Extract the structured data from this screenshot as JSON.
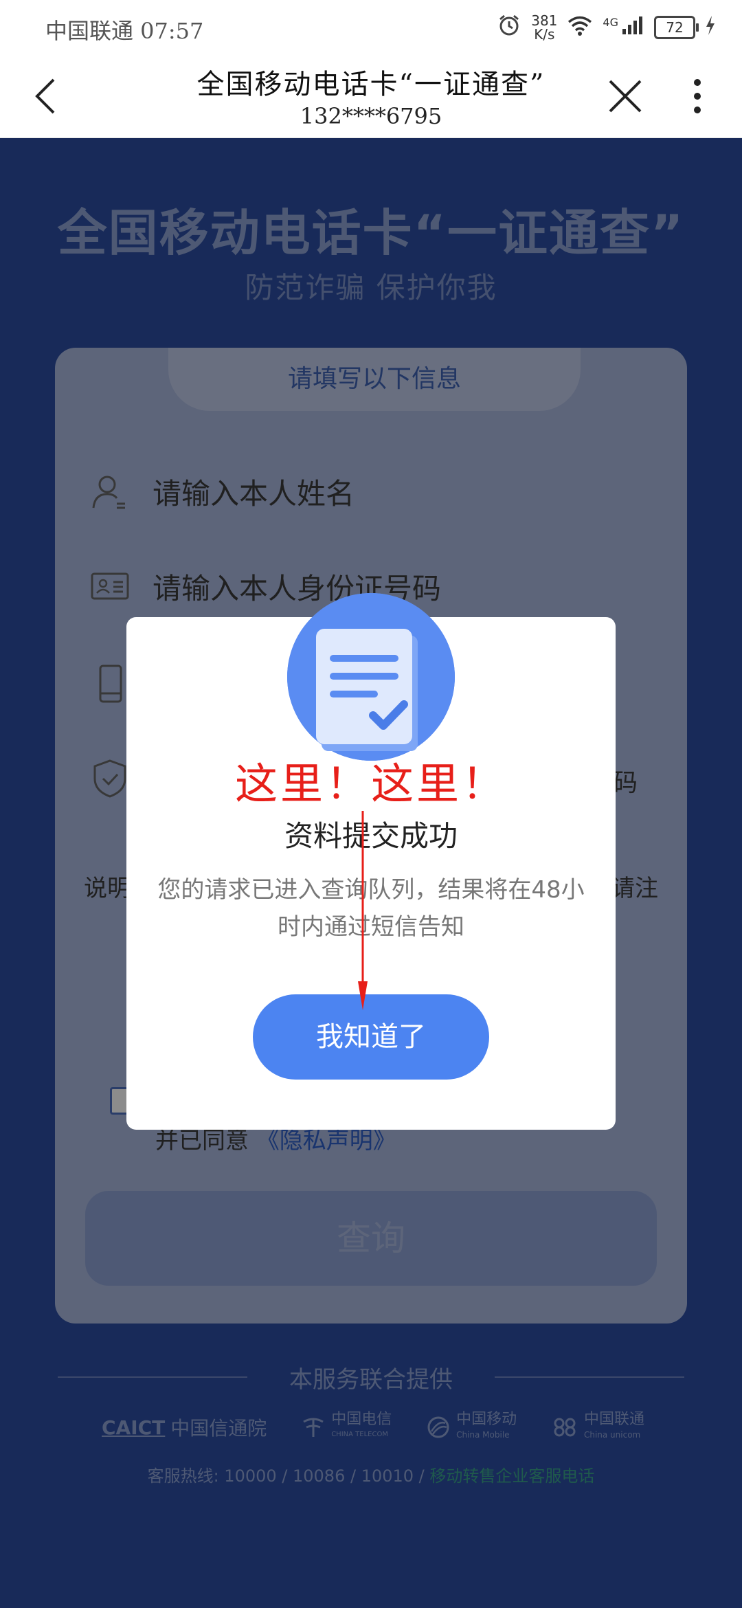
{
  "status_bar": {
    "carrier_time": "中国联通 07:57",
    "speed_value": "381",
    "speed_unit": "K/s",
    "network": "4G",
    "battery": "72"
  },
  "nav": {
    "title": "全国移动电话卡“一证通查”",
    "subtitle": "132****6795"
  },
  "page": {
    "hero_title": "全国移动电话卡“一证通查”",
    "hero_subtitle": "防范诈骗 保护你我",
    "card_tab": "请填写以下信息",
    "name_placeholder": "请输入本人姓名",
    "id_placeholder": "请输入本人身份证号码",
    "side_code_text": "码",
    "note_left": "说明",
    "note_right": "请注",
    "agree_text": "并已同意",
    "agree_link": "《隐私声明》",
    "query_button": "查询"
  },
  "footer": {
    "title": "本服务联合提供",
    "partners": [
      {
        "name": "CAICT",
        "name_cn": "中国信通院"
      },
      {
        "name_cn": "中国电信",
        "name_en": "CHINA TELECOM"
      },
      {
        "name_cn": "中国移动",
        "name_en": "China Mobile"
      },
      {
        "name_cn": "中国联通",
        "name_en": "China unicom"
      }
    ],
    "hotline_prefix": "客服热线: 10000 / 10086 / 10010 /",
    "hotline_link": "移动转售企业客服电话"
  },
  "dialog": {
    "annotation": "这里！这里！",
    "title": "资料提交成功",
    "message": "您的请求已进入查询队列，结果将在48小时内通过短信告知",
    "ok_button": "我知道了"
  },
  "colors": {
    "page_bg": "#2c4da3",
    "card_bg": "#a9b8df",
    "accent_blue": "#4c84f1",
    "annotation_red": "#e71f19",
    "hotline_green": "#3aa58a"
  }
}
